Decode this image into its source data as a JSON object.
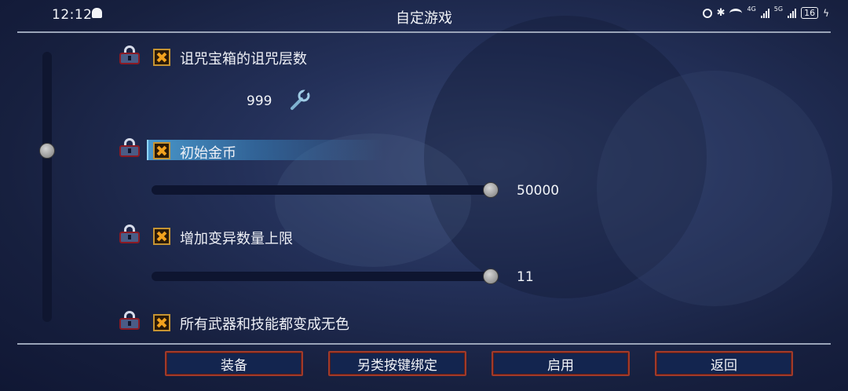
{
  "status_bar": {
    "time": "12:12",
    "network_1": "4G",
    "network_2": "5G",
    "battery": "16"
  },
  "screen_title": "自定游戏",
  "options": [
    {
      "label": "诅咒宝箱的诅咒层数",
      "checked": true,
      "locked": true,
      "value": "999",
      "control": "wrench-edit"
    },
    {
      "label": "初始金币",
      "checked": true,
      "locked": true,
      "selected": true,
      "value": "50000",
      "control": "slider",
      "level": 1.0
    },
    {
      "label": "增加变异数量上限",
      "checked": true,
      "locked": true,
      "value": "11",
      "control": "slider",
      "level": 1.0
    },
    {
      "label": "所有武器和技能都变成无色",
      "checked": true,
      "locked": true
    }
  ],
  "scrollbar": {
    "position": 0.33
  },
  "buttons": {
    "equip": "装备",
    "alt_keybind": "另类按键绑定",
    "enable": "启用",
    "back": "返回"
  },
  "colors": {
    "checkbox_fill": "#f2a21e",
    "highlight": "#50aae1",
    "button_border": "#a13a2a",
    "button_bg": "#13254f"
  }
}
